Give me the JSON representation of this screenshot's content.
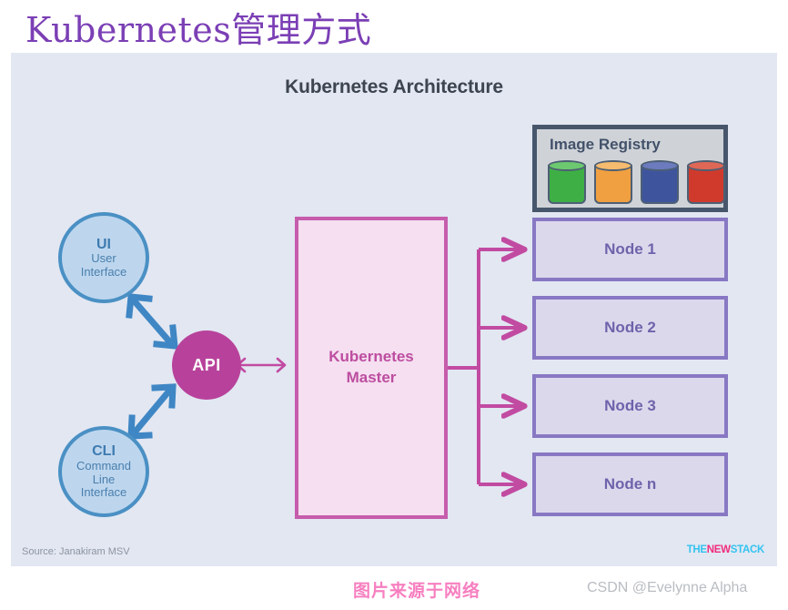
{
  "page": {
    "title": "Kubernetes管理方式",
    "title_color": "#7b3fb5"
  },
  "slide": {
    "background": "#e2e7f2",
    "title": "Kubernetes Architecture",
    "source_note": "Source: Janakiram MSV",
    "logo": {
      "part1": "THE",
      "part2": "NEW",
      "part3": "STACK",
      "color1": "#33c3f0",
      "color2": "#ef2d7e"
    }
  },
  "registry": {
    "label": "Image Registry",
    "border_color": "#47566b",
    "fill_color": "#cfd3d8",
    "cylinders": [
      {
        "name": "green-cylinder",
        "color": "#3eaf45",
        "top": "#6cc96f"
      },
      {
        "name": "orange-cylinder",
        "color": "#f0a040",
        "top": "#f5bb6e"
      },
      {
        "name": "blue-cylinder",
        "color": "#3e559e",
        "top": "#6b7bbd"
      },
      {
        "name": "red-cylinder",
        "color": "#d03a2c",
        "top": "#de6755"
      }
    ]
  },
  "nodes": [
    {
      "label": "Node 1"
    },
    {
      "label": "Node 2"
    },
    {
      "label": "Node 3"
    },
    {
      "label": "Node n"
    }
  ],
  "node_style": {
    "fill": "#dcd8ec",
    "border": "#8878c3",
    "text": "#6e63ab"
  },
  "master": {
    "label": "Kubernetes\nMaster",
    "line1": "Kubernetes",
    "line2": "Master",
    "fill": "#f5dff0",
    "border": "#c65cac",
    "text": "#bd4da0"
  },
  "api": {
    "label": "API",
    "fill": "#b8429b",
    "text": "#ffffff"
  },
  "endpoints": [
    {
      "abbr": "UI",
      "lines": [
        "User",
        "Interface"
      ]
    },
    {
      "abbr": "CLI",
      "lines": [
        "Command",
        "Line",
        "Interface"
      ]
    }
  ],
  "endpoint_style": {
    "fill": "#bdd6ee",
    "border": "#4a90c4",
    "text": "#4a7fad"
  },
  "arrow_colors": {
    "blue": "#3f86c4",
    "magenta": "#c24ba2"
  },
  "watermarks": {
    "chinese": "图片来源于网络",
    "csdn": "CSDN @Evelynne Alpha",
    "chinese_color": "#f77fc0",
    "csdn_color": "#b9bdc2"
  }
}
